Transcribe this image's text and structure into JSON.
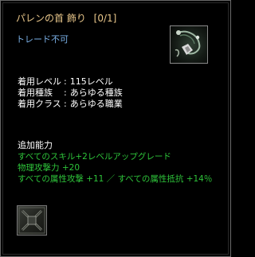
{
  "item": {
    "name": "パレンの首 飾り",
    "count_label": "[0/1]",
    "trade_status": "トレード不可",
    "icon": "necklace-icon"
  },
  "requirements": [
    {
      "key": "着用レベル",
      "value": "115レベル"
    },
    {
      "key": "着用種族",
      "value": "あらゆる種族"
    },
    {
      "key": "着用クラス",
      "value": "あらゆる職業"
    }
  ],
  "bonuses": {
    "heading": "追加能力",
    "lines": [
      "すべてのスキル+2レベルアップグレード",
      "物理攻撃力 +20",
      "すべての属性攻撃 +11 ／ すべての属性抵抗 +14％"
    ]
  },
  "socket": {
    "icon": "rune-slot-icon"
  },
  "colors": {
    "title": "#e8c68a",
    "trade_status": "#7ab0e6",
    "bonus_text": "#2ec43a",
    "border": "#6a6a6a"
  }
}
